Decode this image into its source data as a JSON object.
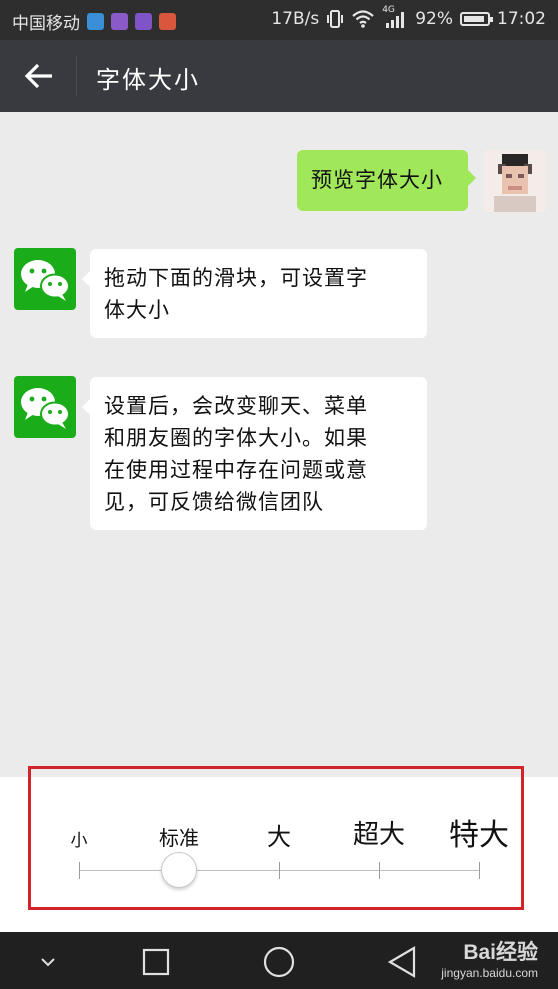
{
  "status_bar": {
    "carrier": "中国移动",
    "speed": "17B/s",
    "network": "4G",
    "battery": "92%",
    "battery_level": 0.92,
    "time": "17:02"
  },
  "title_bar": {
    "title": "字体大小"
  },
  "messages": [
    {
      "from": "user",
      "text": "预览字体大小"
    },
    {
      "from": "wechat",
      "line1": "拖动下面的滑块，可设置字",
      "line2": "体大小"
    },
    {
      "from": "wechat",
      "line1": "设置后，会改变聊天、菜单",
      "line2": "和朋友圈的字体大小。如果",
      "line3": "在使用过程中存在问题或意",
      "line4": "见，可反馈给微信团队"
    }
  ],
  "font_size_panel": {
    "labels": [
      "小",
      "标准",
      "大",
      "超大",
      "特大"
    ],
    "selected": "标准"
  },
  "watermark": {
    "brand": "Bai经验",
    "url": "jingyan.baidu.com"
  },
  "colors": {
    "titlebar": "#393a3f",
    "bubble_green": "#a0e75a",
    "wechat_green": "#1aad19",
    "highlight_red": "#d0232a"
  }
}
